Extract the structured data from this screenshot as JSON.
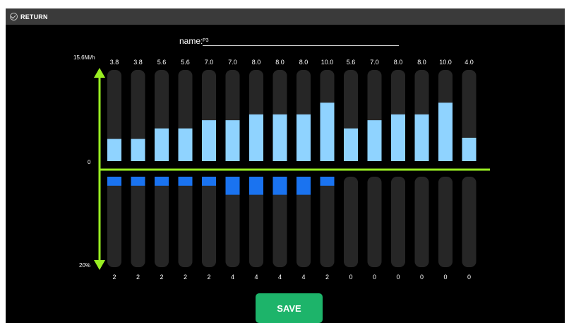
{
  "topbar": {
    "return_label": "RETURN",
    "check_icon": "check-circle-icon"
  },
  "name_field": {
    "label": "name:",
    "value": "P3"
  },
  "axis": {
    "top_label": "15.6Mi/h",
    "zero_label": "0",
    "bottom_label": "20%"
  },
  "colors": {
    "axis_green": "#99ee22",
    "speed_bar": "#8fd3ff",
    "incline_bar": "#1a73f0",
    "track": "#262626",
    "save": "#1db46a"
  },
  "chart_data": {
    "type": "bar",
    "speed": {
      "max": 15.6,
      "values": [
        3.8,
        3.8,
        5.6,
        5.6,
        7.0,
        7.0,
        8.0,
        8.0,
        8.0,
        10.0,
        5.6,
        7.0,
        8.0,
        8.0,
        10.0,
        4.0
      ],
      "labels": [
        "3.8",
        "3.8",
        "5.6",
        "5.6",
        "7.0",
        "7.0",
        "8.0",
        "8.0",
        "8.0",
        "10.0",
        "5.6",
        "7.0",
        "8.0",
        "8.0",
        "10.0",
        "4.0"
      ]
    },
    "incline": {
      "max": 20,
      "values": [
        2,
        2,
        2,
        2,
        2,
        4,
        4,
        4,
        4,
        2,
        0,
        0,
        0,
        0,
        0,
        0
      ],
      "labels": [
        "2",
        "2",
        "2",
        "2",
        "2",
        "4",
        "4",
        "4",
        "4",
        "2",
        "0",
        "0",
        "0",
        "0",
        "0",
        "0"
      ]
    }
  },
  "save_label": "SAVE"
}
